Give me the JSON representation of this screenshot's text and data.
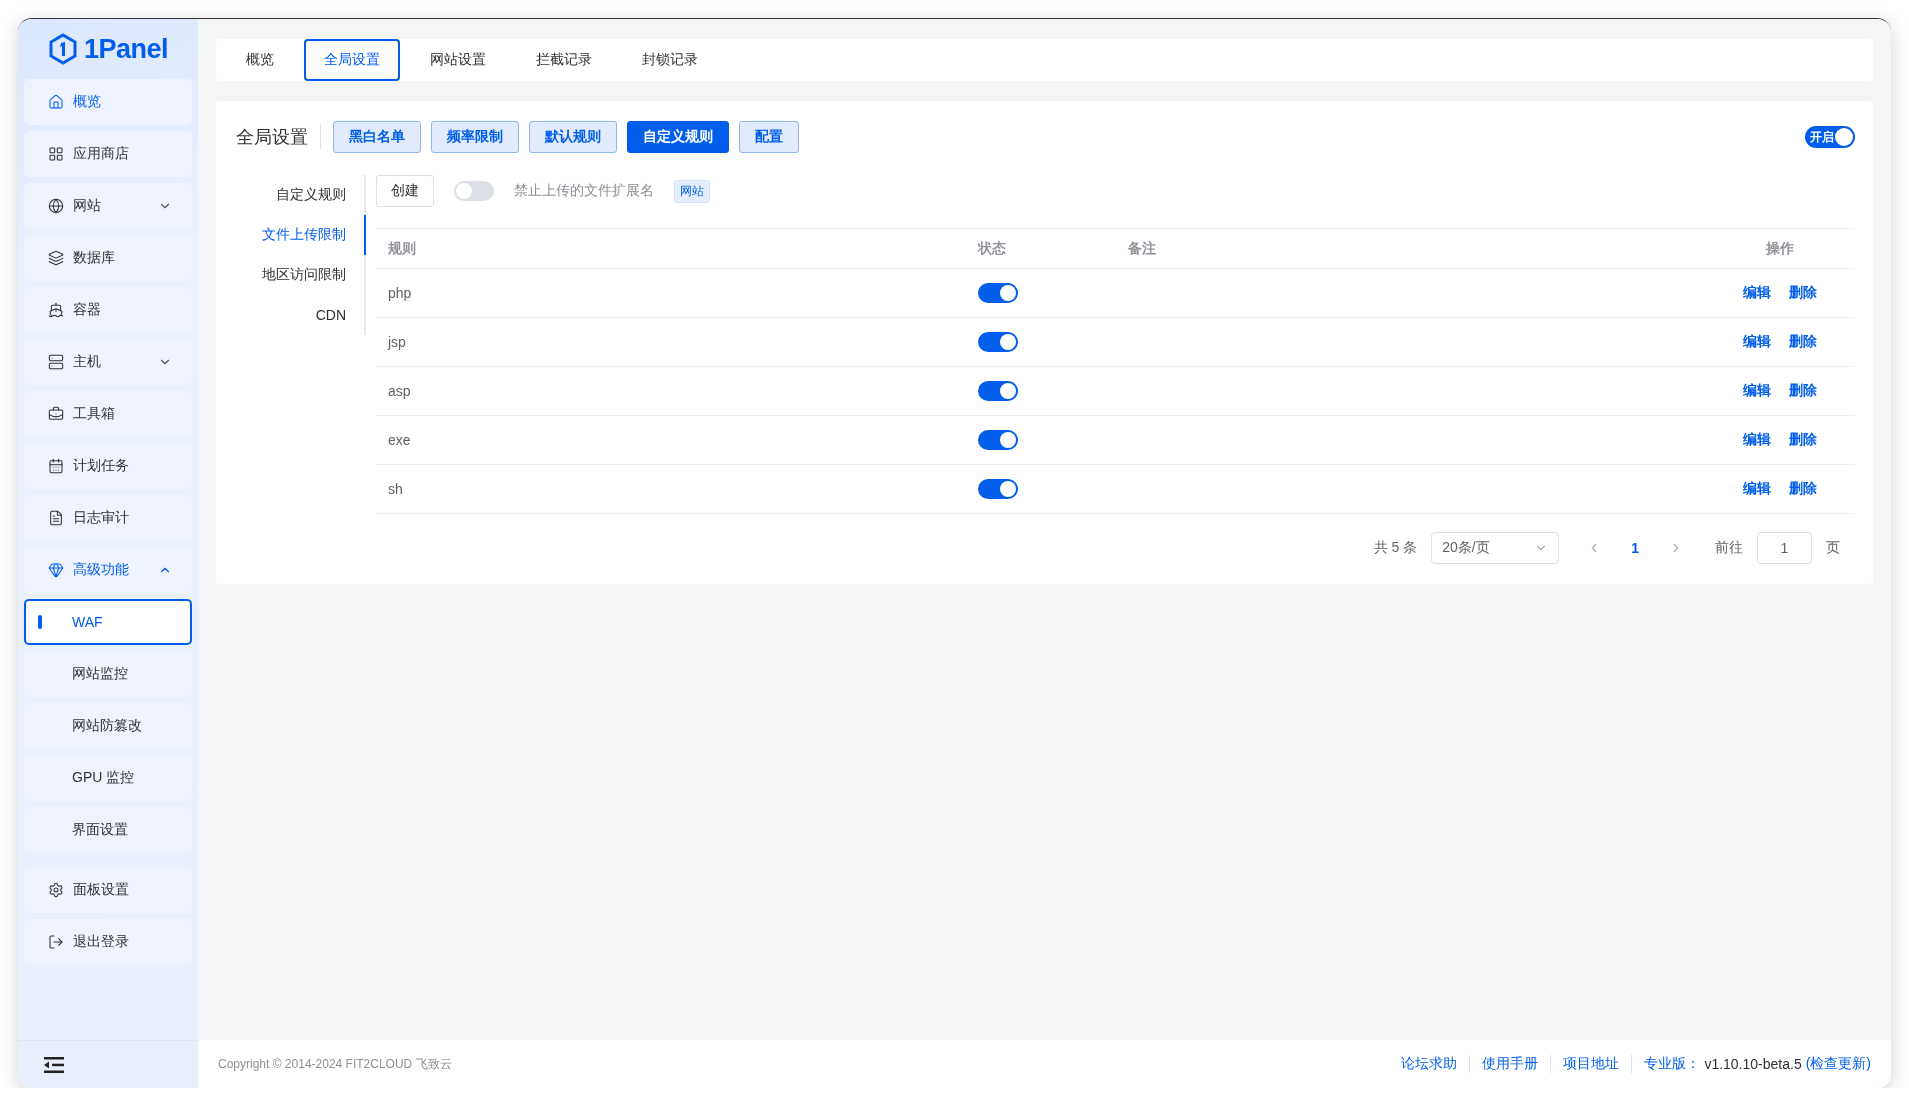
{
  "logo": {
    "text": "1Panel"
  },
  "sidebar": {
    "items": [
      {
        "label": "概览",
        "active": true
      },
      {
        "label": "应用商店",
        "active": false
      },
      {
        "label": "网站",
        "active": false,
        "expanded": false
      },
      {
        "label": "数据库",
        "active": false
      },
      {
        "label": "容器",
        "active": false
      },
      {
        "label": "主机",
        "active": false,
        "expanded": false
      },
      {
        "label": "工具箱",
        "active": false
      },
      {
        "label": "计划任务",
        "active": false
      },
      {
        "label": "日志审计",
        "active": false
      },
      {
        "label": "高级功能",
        "active": true,
        "expanded": true,
        "children": [
          {
            "label": "WAF",
            "selected": true
          },
          {
            "label": "网站监控",
            "selected": false
          },
          {
            "label": "网站防篡改",
            "selected": false
          },
          {
            "label": "GPU 监控",
            "selected": false
          },
          {
            "label": "界面设置",
            "selected": false
          }
        ]
      }
    ],
    "bottom_items": [
      {
        "label": "面板设置"
      },
      {
        "label": "退出登录"
      }
    ]
  },
  "tabs": [
    {
      "label": "概览",
      "selected": false
    },
    {
      "label": "全局设置",
      "selected": true
    },
    {
      "label": "网站设置",
      "selected": false
    },
    {
      "label": "拦截记录",
      "selected": false
    },
    {
      "label": "封锁记录",
      "selected": false
    }
  ],
  "panel": {
    "title": "全局设置",
    "buttons": [
      {
        "label": "黑白名单",
        "selected": false
      },
      {
        "label": "频率限制",
        "selected": false
      },
      {
        "label": "默认规则",
        "selected": false
      },
      {
        "label": "自定义规则",
        "selected": true
      },
      {
        "label": "配置",
        "selected": false
      }
    ],
    "switch": {
      "label": "开启",
      "on": true
    },
    "subnav": [
      {
        "label": "自定义规则",
        "selected": false
      },
      {
        "label": "文件上传限制",
        "selected": true
      },
      {
        "label": "地区访问限制",
        "selected": false
      },
      {
        "label": "CDN",
        "selected": false
      }
    ],
    "toolbar": {
      "create": "创建",
      "toggle_on": false,
      "toggle_label": "禁止上传的文件扩展名",
      "tag": "网站"
    },
    "table": {
      "columns": [
        "规则",
        "状态",
        "备注",
        "操作"
      ],
      "rows": [
        {
          "rule": "php",
          "enabled": true,
          "actions": [
            "编辑",
            "删除"
          ]
        },
        {
          "rule": "jsp",
          "enabled": true,
          "actions": [
            "编辑",
            "删除"
          ]
        },
        {
          "rule": "asp",
          "enabled": true,
          "actions": [
            "编辑",
            "删除"
          ]
        },
        {
          "rule": "exe",
          "enabled": true,
          "actions": [
            "编辑",
            "删除"
          ]
        },
        {
          "rule": "sh",
          "enabled": true,
          "actions": [
            "编辑",
            "删除"
          ]
        }
      ]
    },
    "pagination": {
      "total": "共 5 条",
      "page_size": "20条/页",
      "current": "1",
      "goto_label": "前往",
      "goto_value": "1",
      "goto_suffix": "页"
    }
  },
  "footer": {
    "copyright": "Copyright © 2014-2024 FIT2CLOUD 飞致云",
    "links": [
      "论坛求助",
      "使用手册",
      "项目地址"
    ],
    "edition": "专业版：",
    "version": "v1.10.10-beta.5",
    "update": "(检查更新)"
  }
}
